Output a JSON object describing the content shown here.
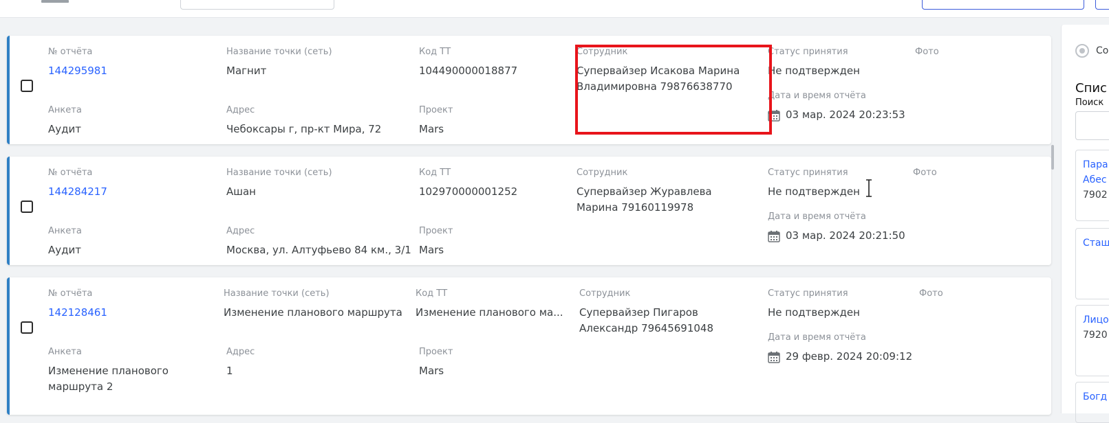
{
  "colors": {
    "accent": "#2962ff",
    "card_border": "#2f80c4",
    "highlight": "#e8141b"
  },
  "labels": {
    "report_no": "№ отчёта",
    "point_name": "Название точки (сеть)",
    "tt_code": "Код ТТ",
    "employee": "Сотрудник",
    "status": "Статус принятия",
    "photo": "Фото",
    "survey": "Анкета",
    "address": "Адрес",
    "project": "Проект",
    "datetime": "Дата и время отчёта"
  },
  "reports": [
    {
      "report_no": "144295981",
      "point_name": "Магнит",
      "tt_code": "104490000018877",
      "employee": "Супервайзер Исакова Марина Владимировна 79876638770",
      "status": "Не подтвержден",
      "survey": "Аудит",
      "address": "Чебоксары г, пр-кт Мира, 72",
      "project": "Mars",
      "datetime": "03 мар. 2024 20:23:53",
      "highlighted": true
    },
    {
      "report_no": "144284217",
      "point_name": "Ашан",
      "tt_code": "102970000001252",
      "employee": "Супервайзер Журавлева Марина 79160119978",
      "status": "Не подтвержден",
      "survey": "Аудит",
      "address": "Москва, ул. Алтуфьево 84 км., 3/1",
      "project": "Mars",
      "datetime": "03 мар. 2024 20:21:50",
      "highlighted": false
    },
    {
      "report_no": "142128461",
      "point_name": "Изменение планового маршрута",
      "tt_code": "Изменение планового ма...",
      "employee": "Супервайзер Пигаров Александр 79645691048",
      "status": "Не подтвержден",
      "survey": "Изменение планового маршрута 2",
      "address": "1",
      "project": "Mars",
      "datetime": "29 февр. 2024 20:09:12",
      "highlighted": false
    }
  ],
  "right_panel": {
    "radio_label": "Со",
    "title": "Спис",
    "search_label": "Поиск",
    "cards": [
      {
        "lines": [
          "Пара",
          "Абес",
          "7902"
        ]
      },
      {
        "lines": [
          "Стащ"
        ]
      },
      {
        "lines": [
          "Лицо",
          "7920"
        ]
      },
      {
        "lines": [
          "Богд"
        ]
      }
    ]
  }
}
